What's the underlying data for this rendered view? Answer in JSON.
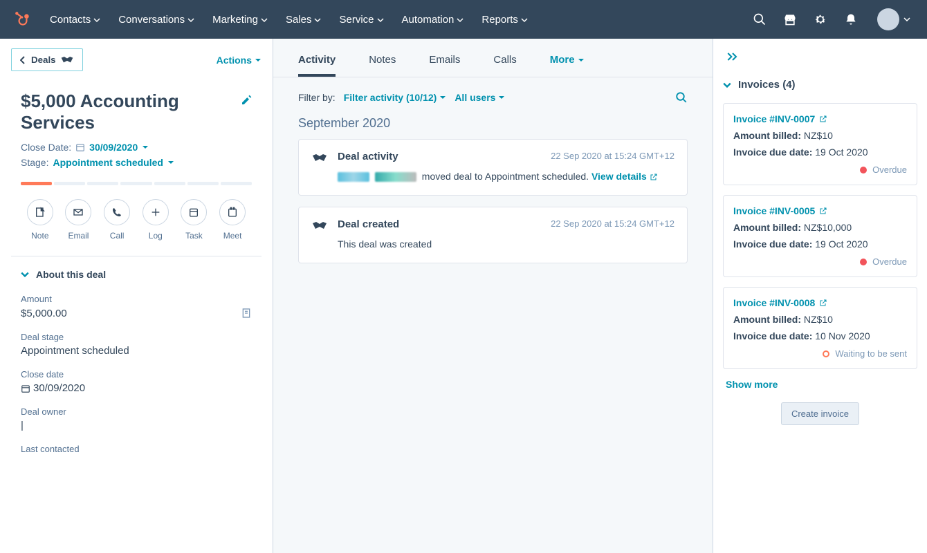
{
  "nav": {
    "items": [
      "Contacts",
      "Conversations",
      "Marketing",
      "Sales",
      "Service",
      "Automation",
      "Reports"
    ]
  },
  "left": {
    "back_label": "Deals",
    "actions_label": "Actions",
    "deal_title": "$5,000 Accounting Services",
    "close_date_label": "Close Date:",
    "close_date_value": "30/09/2020",
    "stage_label": "Stage:",
    "stage_value": "Appointment scheduled",
    "quick_actions": [
      {
        "key": "note",
        "label": "Note"
      },
      {
        "key": "email",
        "label": "Email"
      },
      {
        "key": "call",
        "label": "Call"
      },
      {
        "key": "log",
        "label": "Log"
      },
      {
        "key": "task",
        "label": "Task"
      },
      {
        "key": "meet",
        "label": "Meet"
      }
    ],
    "about_title": "About this deal",
    "amount_label": "Amount",
    "amount_value": "$5,000.00",
    "dealstage_label": "Deal stage",
    "dealstage_value": "Appointment scheduled",
    "closedate_label": "Close date",
    "closedate_value": "30/09/2020",
    "owner_label": "Deal owner",
    "owner_value": "|",
    "lastcontacted_label": "Last contacted"
  },
  "center": {
    "tabs": [
      "Activity",
      "Notes",
      "Emails",
      "Calls"
    ],
    "more_label": "More",
    "filter_label": "Filter by:",
    "filter_activity": "Filter activity (10/12)",
    "filter_users": "All users",
    "month": "September 2020",
    "cards": [
      {
        "title": "Deal activity",
        "time": "22 Sep 2020 at 15:24 GMT+12",
        "body_tail": "moved deal to Appointment scheduled.",
        "view_label": "View details"
      },
      {
        "title": "Deal created",
        "time": "22 Sep 2020 at 15:24 GMT+12",
        "body": "This deal was created"
      }
    ]
  },
  "right": {
    "invoices_title": "Invoices (4)",
    "invoices": [
      {
        "name": "Invoice #INV-0007",
        "billed_label": "Amount billed:",
        "billed": "NZ$10",
        "due_label": "Invoice due date:",
        "due": "19 Oct 2020",
        "status": "Overdue",
        "status_kind": "overdue"
      },
      {
        "name": "Invoice #INV-0005",
        "billed_label": "Amount billed:",
        "billed": "NZ$10,000",
        "due_label": "Invoice due date:",
        "due": "19 Oct 2020",
        "status": "Overdue",
        "status_kind": "overdue"
      },
      {
        "name": "Invoice #INV-0008",
        "billed_label": "Amount billed:",
        "billed": "NZ$10",
        "due_label": "Invoice due date:",
        "due": "10 Nov 2020",
        "status": "Waiting to be sent",
        "status_kind": "waiting"
      }
    ],
    "show_more": "Show more",
    "create_invoice": "Create invoice"
  }
}
